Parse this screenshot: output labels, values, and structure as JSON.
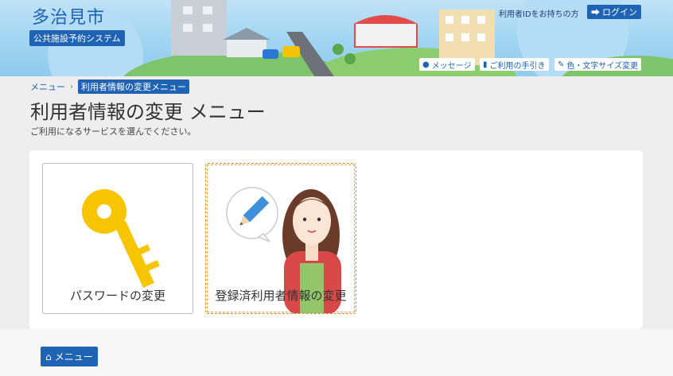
{
  "header": {
    "city_name": "多治見市",
    "system_name": "公共施設予約システム",
    "have_id_text": "利用者IDをお持ちの方",
    "login_label": "ログイン",
    "links": [
      {
        "label": "メッセージ",
        "icon": "message-icon"
      },
      {
        "label": "ご利用の手引き",
        "icon": "book-icon"
      },
      {
        "label": "色・文字サイズ変更",
        "icon": "brush-icon"
      }
    ]
  },
  "breadcrumb": {
    "items": [
      "メニュー",
      "利用者情報の変更メニュー"
    ]
  },
  "page": {
    "title": "利用者情報の変更 メニュー",
    "lead": "ご利用になるサービスを選んでください。"
  },
  "cards": [
    {
      "label": "パスワードの変更",
      "icon": "key-icon"
    },
    {
      "label": "登録済利用者情報の変更",
      "icon": "person-with-pencil-icon"
    }
  ],
  "footer": {
    "menu_label": "メニュー",
    "menu_icon": "home-icon"
  },
  "colors": {
    "brand": "#1f63b4",
    "selected_border": "#e08a2c",
    "key": "#f7c400"
  }
}
